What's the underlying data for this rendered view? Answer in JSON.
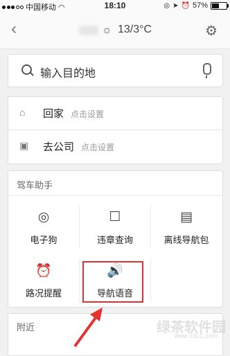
{
  "status": {
    "carrier": "中国移动",
    "time": "18:10",
    "battery": "57%",
    "battery_level": 0.57
  },
  "nav": {
    "weather": "13/3°C"
  },
  "search": {
    "placeholder": "输入目的地"
  },
  "places": [
    {
      "label": "回家",
      "hint": "点击设置",
      "icon": "home-icon"
    },
    {
      "label": "去公司",
      "hint": "点击设置",
      "icon": "briefcase-icon"
    }
  ],
  "assistant": {
    "title": "驾车助手",
    "tiles": [
      {
        "label": "电子狗",
        "icon": "camera-icon"
      },
      {
        "label": "违章查询",
        "icon": "violation-camera-icon"
      },
      {
        "label": "离线导航包",
        "icon": "offline-package-icon"
      },
      {
        "label": "路况提醒",
        "icon": "alarm-clock-icon"
      },
      {
        "label": "导航语音",
        "icon": "speaker-icon"
      }
    ]
  },
  "nearby": {
    "title": "附近"
  },
  "watermark": {
    "text": "绿茶软件园",
    "url": "www.33LC.com"
  },
  "colors": {
    "highlight": "#e53030",
    "background": "#f1f1f1"
  }
}
